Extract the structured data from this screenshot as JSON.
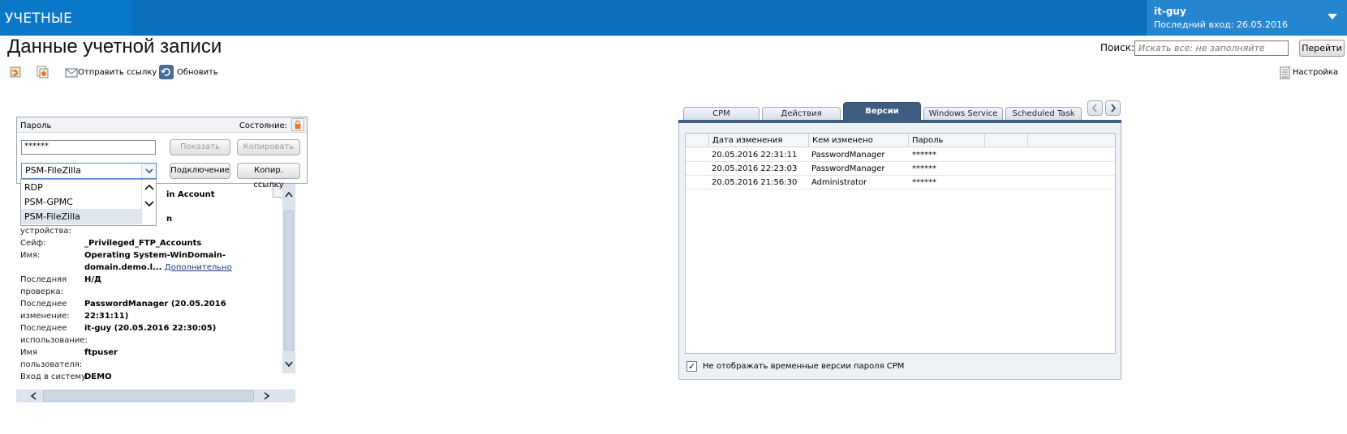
{
  "header": {
    "app_title": "УЧЕТНЫЕ ЗАПИСИ",
    "user_name": "it-guy",
    "last_login": "Последний вход: 26.05.2016"
  },
  "page": {
    "title": "Данные учетной записи"
  },
  "search": {
    "label": "Поиск:",
    "placeholder": "Искать все: не заполняйте",
    "go_label": "Перейти"
  },
  "toolbar": {
    "send_link_label": "Отправить ссылку",
    "refresh_label": "Обновить",
    "settings_label": "Настройка"
  },
  "password_panel": {
    "password_label": "Пароль",
    "state_label": "Состояние:",
    "masked_value": "******",
    "show_label": "Показать",
    "copy_label": "Копировать",
    "connect_label": "Подключение",
    "copy_link_label": "Копир. ссылку",
    "connection_selected": "PSM-FileZilla",
    "connection_options": [
      "RDP",
      "PSM-GPMC",
      "PSM-FileZilla"
    ]
  },
  "details": {
    "partial_top_value": "in Account",
    "partial_second_value": "n",
    "partial_third_label": "устройства:",
    "safe_label": "Сейф:",
    "safe_value": "_Privileged_FTP_Accounts",
    "name_label": "Имя:",
    "name_value_1": "Operating System-WinDomain-",
    "name_value_2": "domain.demo.l...",
    "name_more_link": "Дополнительно",
    "last_check_label": "Последняя проверка:",
    "last_check_value": "Н/Д",
    "last_change_label": "Последнее изменение:",
    "last_change_value": "PasswordManager (20.05.2016 22:31:11)",
    "last_use_label": "Последнее использование:",
    "last_use_value": "it-guy (20.05.2016 22:30:05)",
    "username_label": "Имя пользователя:",
    "username_value": "ftpuser",
    "logon_label": "Вход в систему",
    "logon_value": "DEMO"
  },
  "tabs": [
    {
      "label": "CPM"
    },
    {
      "label": "Действия"
    },
    {
      "label": "Версии"
    },
    {
      "label": "Windows Service"
    },
    {
      "label": "Scheduled Task"
    }
  ],
  "versions_table": {
    "headers": [
      "Дата изменения",
      "Кем изменено",
      "Пароль"
    ],
    "rows": [
      [
        "20.05.2016 22:31:11",
        "PasswordManager",
        "******"
      ],
      [
        "20.05.2016 22:23:03",
        "PasswordManager",
        "******"
      ],
      [
        "20.05.2016 21:56:30",
        "Administrator",
        "******"
      ]
    ]
  },
  "versions_checkbox": {
    "label": "Не отображать временные версии пароля CPM",
    "checked": true
  },
  "colors": {
    "header_blue": "#0a6ebd",
    "active_tab": "#3e5d82"
  }
}
